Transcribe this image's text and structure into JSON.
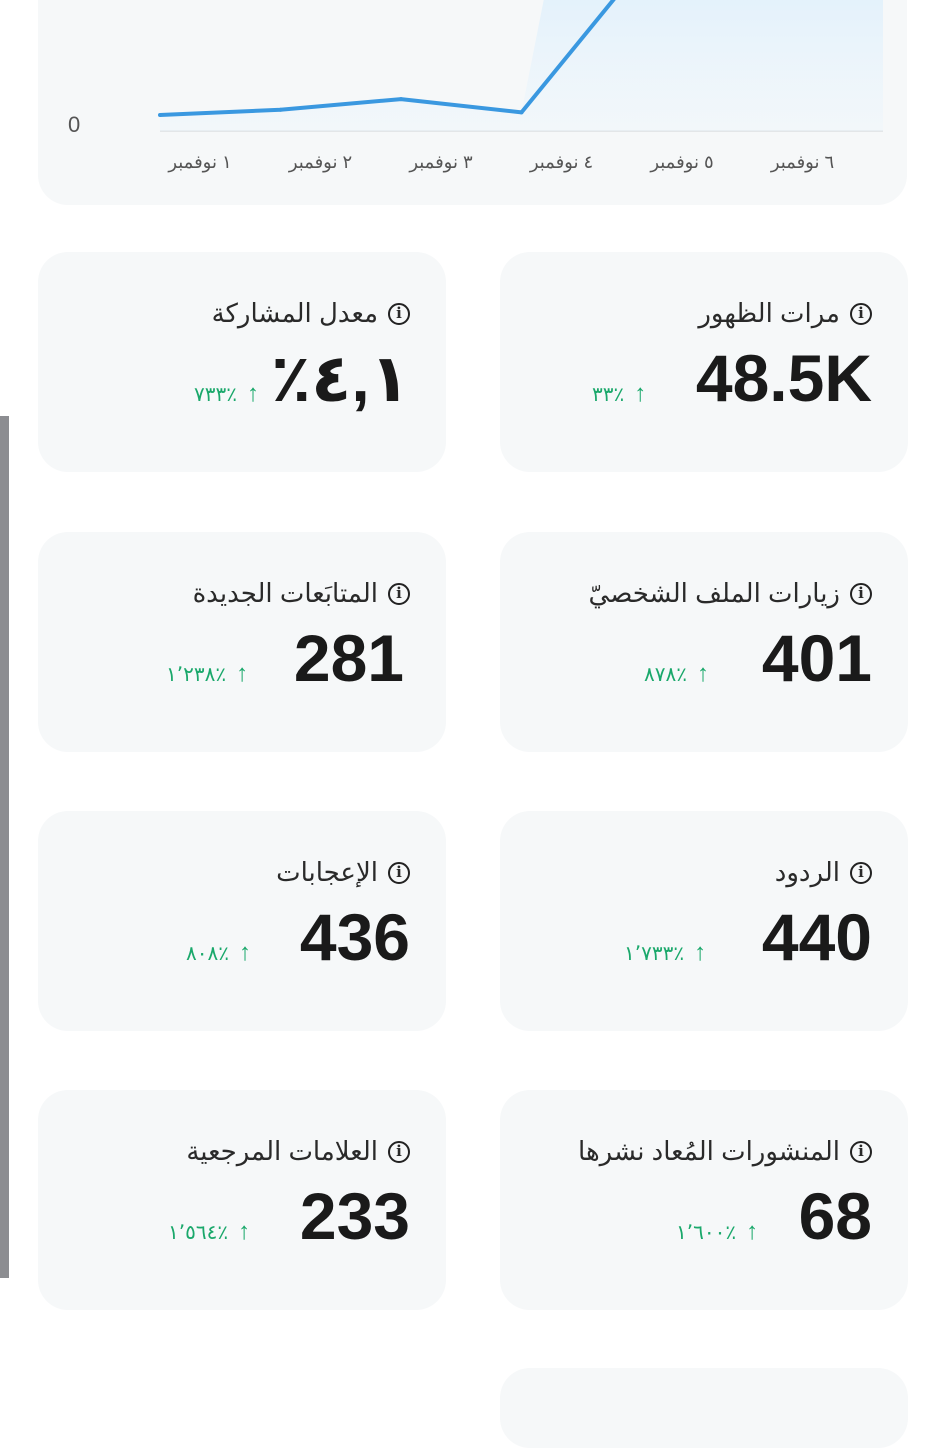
{
  "chart_data": {
    "type": "area",
    "y_tick_labels": [
      "0"
    ],
    "categories": [
      "١ نوفمبر",
      "٢ نوفمبر",
      "٣ نوفمبر",
      "٤ نوفمبر",
      "٥ نوفمبر",
      "٦ نوفمبر"
    ],
    "values": [
      0.12,
      0.16,
      0.24,
      0.14,
      1.25,
      null
    ],
    "ylim": [
      0,
      1
    ],
    "grid": false,
    "line_color": "#3a98e0"
  },
  "metrics": [
    {
      "title": "مرات الظهور",
      "value": "48.5K",
      "change": "٣٣٪"
    },
    {
      "title": "معدل المشاركة",
      "value": "٤,١٪",
      "change": "٧٣٣٪"
    },
    {
      "title": "زيارات الملف الشخصيّ",
      "value": "401",
      "change": "٨٧٨٪"
    },
    {
      "title": "المتابَعات الجديدة",
      "value": "281",
      "change": "١٬٢٣٨٪"
    },
    {
      "title": "الردود",
      "value": "440",
      "change": "١٬٧٣٣٪"
    },
    {
      "title": "الإعجابات",
      "value": "436",
      "change": "٨٠٨٪"
    },
    {
      "title": "المنشورات المُعاد نشرها",
      "value": "68",
      "change": "١٬٦٠٠٪"
    },
    {
      "title": "العلامات المرجعية",
      "value": "233",
      "change": "١٬٥٦٤٪"
    }
  ],
  "colors": {
    "positive": "#1aa86b",
    "card_bg": "#f6f8f9"
  },
  "icons": {
    "info": "info-icon",
    "up": "arrow-up-icon"
  }
}
